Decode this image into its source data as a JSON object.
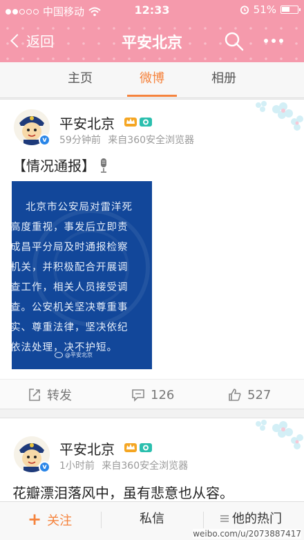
{
  "status_bar": {
    "carrier": "中国移动",
    "time": "12:33",
    "battery": "51%",
    "signal_bars_filled": 2,
    "signal_bars_total": 5
  },
  "nav": {
    "back_label": "返回",
    "title": "平安北京"
  },
  "tabs": [
    {
      "label": "主页",
      "active": false
    },
    {
      "label": "微博",
      "active": true
    },
    {
      "label": "相册",
      "active": false
    }
  ],
  "posts": [
    {
      "author": "平安北京",
      "time": "59分钟前",
      "source": "来自360安全浏览器",
      "text": "【情况通报】",
      "image_lines": [
        "北京市公安局对雷洋死",
        "高度重视，事发后立即责",
        "成昌平分局及时通报检察",
        "机关，并积极配合开展调",
        "查工作，相关人员接受调",
        "查。公安机关坚决尊重事",
        "实、尊重法律，坚决依纪",
        "依法处理，决不护短。"
      ],
      "image_watermark": "@平安北京",
      "repost_label": "转发",
      "comment_count": "126",
      "like_count": "527"
    },
    {
      "author": "平安北京",
      "time": "1小时前",
      "source": "来自360安全浏览器",
      "text": "花瓣漂泪落风中，虽有悲意也从容。"
    }
  ],
  "bottom_bar": {
    "follow_label": "关注",
    "follow_plus": "+",
    "message_label": "私信",
    "hot_label": "他的热门"
  },
  "watermark": "weibo.com/u/2073887417",
  "colors": {
    "header_pink": "#f59aac",
    "accent_orange": "#f5833d",
    "image_blue": "#12479a",
    "verified_blue": "#2a86e8"
  }
}
